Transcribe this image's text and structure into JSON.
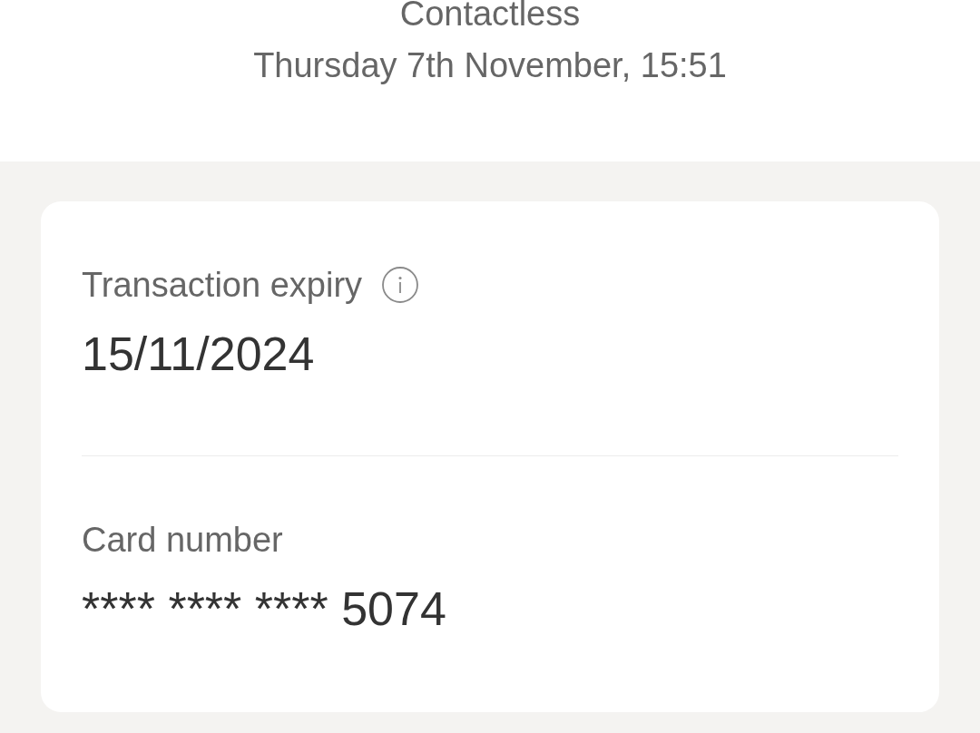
{
  "payment": {
    "method": "Contactless",
    "datetime": "Thursday 7th November, 15:51"
  },
  "details": [
    {
      "label": "Transaction expiry",
      "info": true,
      "value": "15/11/2024"
    },
    {
      "label": "Card number",
      "info": false,
      "value": "**** **** **** 5074"
    }
  ]
}
